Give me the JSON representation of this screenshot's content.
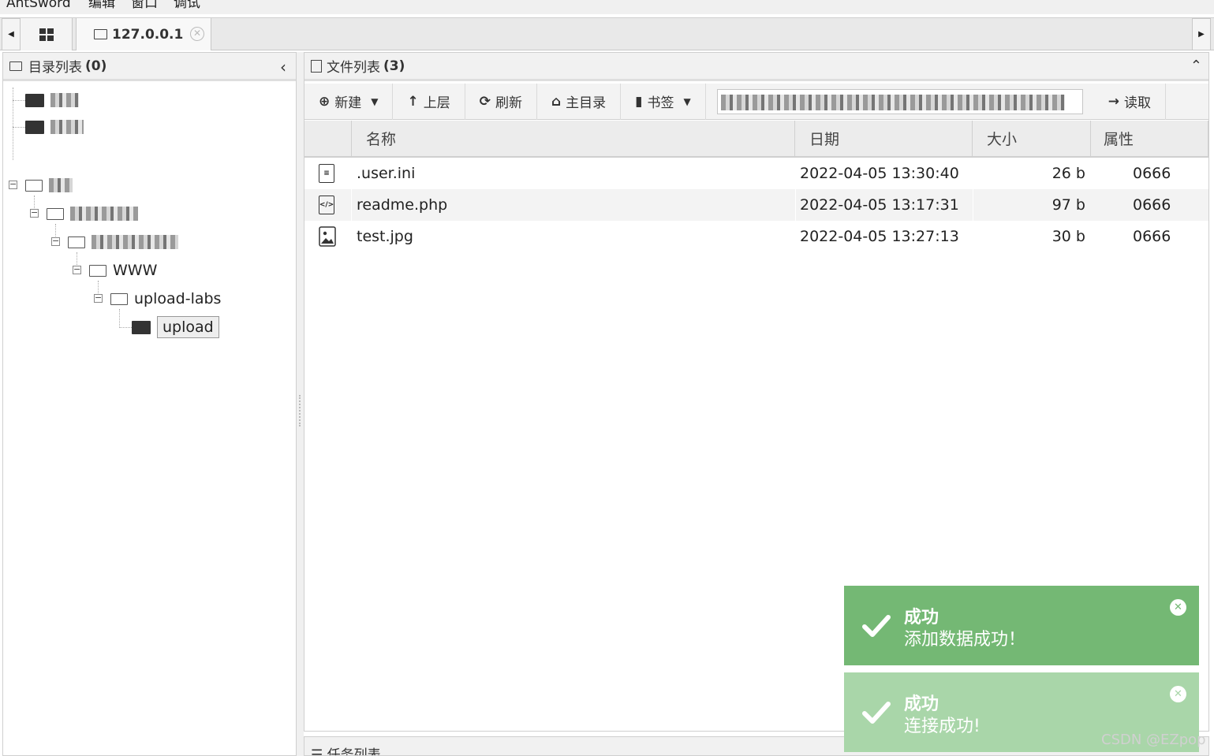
{
  "menubar": {
    "items": [
      "AntSword",
      "编辑",
      "窗口",
      "调试"
    ]
  },
  "tabs": {
    "active_label": "127.0.0.1"
  },
  "dir_panel": {
    "title": "目录列表",
    "count": "(0)"
  },
  "tree": {
    "www": "WWW",
    "upload_labs": "upload-labs",
    "upload": "upload"
  },
  "file_panel": {
    "title": "文件列表",
    "count": "(3)"
  },
  "toolbar": {
    "new": "新建",
    "up": "上层",
    "refresh": "刷新",
    "home": "主目录",
    "bookmark": "书签",
    "read": "读取"
  },
  "columns": {
    "name": "名称",
    "date": "日期",
    "size": "大小",
    "attr": "属性"
  },
  "files": [
    {
      "icon": "text-file-icon",
      "name": ".user.ini",
      "date": "2022-04-05 13:30:40",
      "size": "26 b",
      "attr": "0666"
    },
    {
      "icon": "code-file-icon",
      "name": "readme.php",
      "date": "2022-04-05 13:17:31",
      "size": "97 b",
      "attr": "0666"
    },
    {
      "icon": "image-file-icon",
      "name": "test.jpg",
      "date": "2022-04-05 13:27:13",
      "size": "30 b",
      "attr": "0666"
    }
  ],
  "task_panel": {
    "title": "任务列表"
  },
  "toasts": [
    {
      "title": "成功",
      "message": "添加数据成功！",
      "color": "#74b874"
    },
    {
      "title": "成功",
      "message": "连接成功!",
      "color": "#a9d6a9"
    }
  ],
  "watermark": "CSDN @EZpop"
}
